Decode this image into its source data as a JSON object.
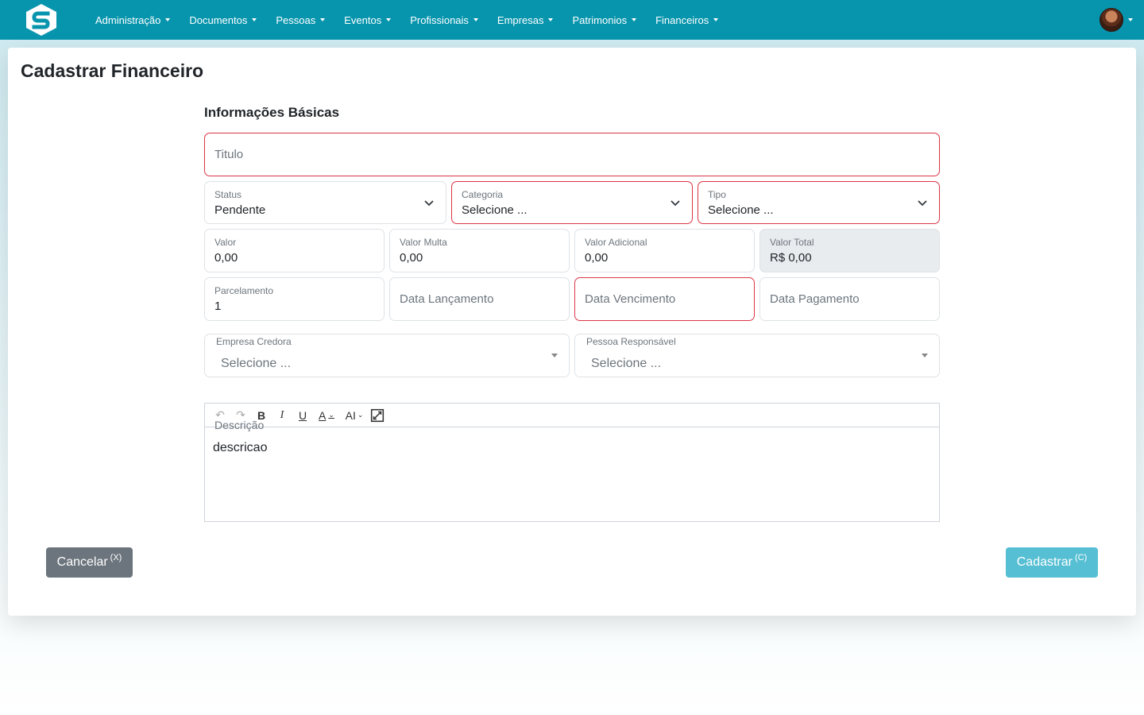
{
  "nav": {
    "logo_icon": "brand-s-logo-icon",
    "items": [
      {
        "label": "Administração"
      },
      {
        "label": "Documentos"
      },
      {
        "label": "Pessoas"
      },
      {
        "label": "Eventos"
      },
      {
        "label": "Profissionais"
      },
      {
        "label": "Empresas"
      },
      {
        "label": "Patrimonios"
      },
      {
        "label": "Financeiros"
      }
    ]
  },
  "page": {
    "title": "Cadastrar Financeiro",
    "section_title": "Informações Básicas"
  },
  "form": {
    "titulo": {
      "placeholder": "Titulo"
    },
    "status": {
      "label": "Status",
      "value": "Pendente"
    },
    "categoria": {
      "label": "Categoria",
      "value": "Selecione ..."
    },
    "tipo": {
      "label": "Tipo",
      "value": "Selecione ..."
    },
    "valor": {
      "label": "Valor",
      "value": "0,00"
    },
    "valor_multa": {
      "label": "Valor Multa",
      "value": "0,00"
    },
    "valor_adicional": {
      "label": "Valor Adicional",
      "value": "0,00"
    },
    "valor_total": {
      "label": "Valor Total",
      "value": "R$ 0,00"
    },
    "parcelamento": {
      "label": "Parcelamento",
      "value": "1"
    },
    "data_lancamento": {
      "placeholder": "Data Lançamento"
    },
    "data_vencimento": {
      "placeholder": "Data Vencimento"
    },
    "data_pagamento": {
      "placeholder": "Data Pagamento"
    },
    "empresa_credora": {
      "label": "Empresa Credora",
      "placeholder": "Selecione ..."
    },
    "pessoa_responsavel": {
      "label": "Pessoa Responsável",
      "placeholder": "Selecione ..."
    },
    "descricao": {
      "label": "Descrição",
      "content": "descricao"
    }
  },
  "editor_toolbar": {
    "undo": "↶",
    "redo": "↷",
    "bold": "B",
    "italic": "I",
    "underline": "U",
    "font_color": "A",
    "font_size": "AI"
  },
  "actions": {
    "cancel": {
      "label": "Cancelar",
      "shortcut": "(X)"
    },
    "submit": {
      "label": "Cadastrar",
      "shortcut": "(C)"
    }
  },
  "colors": {
    "navbar": "#0795ad",
    "invalid_border": "#dc3545",
    "cancel_button": "#6c757d",
    "submit_button": "#56bfd3"
  }
}
